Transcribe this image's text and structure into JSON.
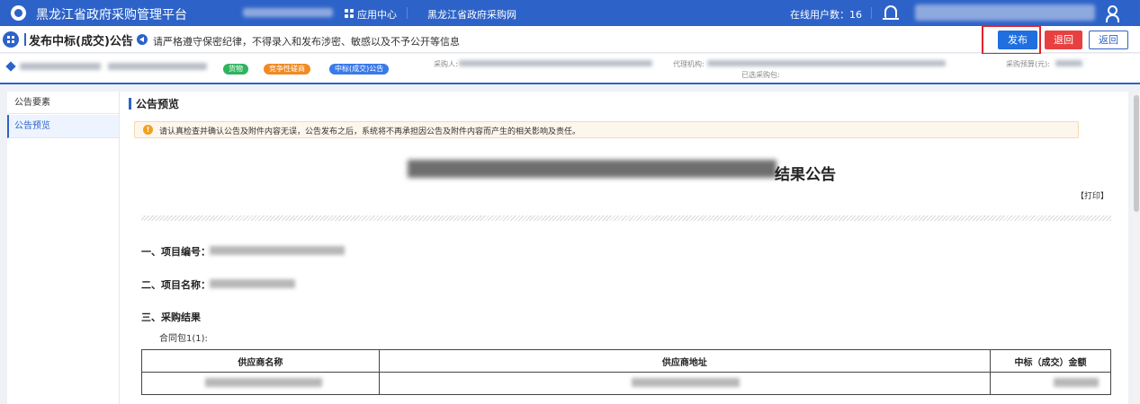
{
  "topbar": {
    "app_title": "黑龙江省政府采购管理平台",
    "apps_label": "应用中心",
    "site_link": "黑龙江省政府采购网",
    "online_users": "在线用户数：16",
    "icons": [
      "logo-icon",
      "apps-grid-icon",
      "bell-icon",
      "user-icon"
    ]
  },
  "page_header": {
    "title": "发布中标(成交)公告",
    "notice": "请严格遵守保密纪律，不得录入和发布涉密、敏感以及不予公开等信息",
    "publish_label": "发布",
    "reject_label": "退回",
    "back_label": "返回",
    "accent_color": "#2d63c8",
    "highlight_color": "#e0232b"
  },
  "info_strip": {
    "tags": [
      "货物",
      "竞争性磋商",
      "中标(成交)公告"
    ],
    "purchaser_label": "采购人:",
    "agency_label": "代理机构:",
    "selected_package": "已选采购包:",
    "budget_label": "采购预算(元):"
  },
  "sidebar": {
    "items": [
      {
        "label": "公告要素"
      },
      {
        "label": "公告预览"
      }
    ]
  },
  "preview": {
    "section_title": "公告预览",
    "warning": "请认真检查并确认公告及附件内容无误，公告发布之后，系统将不再承担因公告及附件内容而产生的相关影响及责任。",
    "doc_title_suffix": "结果公告",
    "print_label": "【打印】",
    "fields": [
      {
        "label": "一、项目编号："
      },
      {
        "label": "二、项目名称："
      },
      {
        "label": "三、采购结果"
      }
    ],
    "package_label": "合同包1(1):",
    "table": {
      "headers": [
        "供应商名称",
        "供应商地址",
        "中标（成交）金额"
      ]
    }
  }
}
